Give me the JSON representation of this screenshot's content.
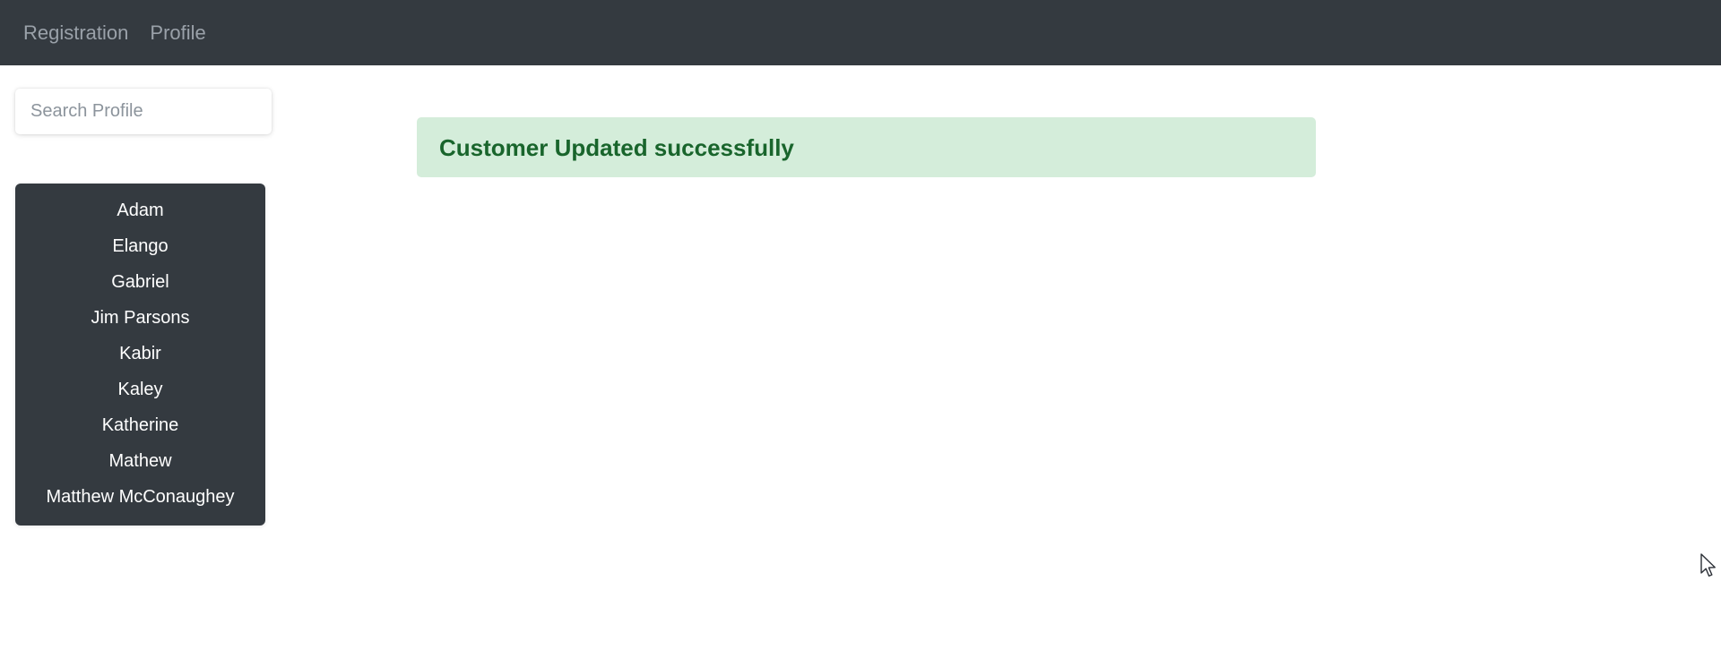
{
  "navbar": {
    "background_color": "#343a40",
    "links": [
      {
        "label": "Registration"
      },
      {
        "label": "Profile"
      }
    ]
  },
  "sidebar": {
    "search": {
      "placeholder": "Search Profile",
      "value": ""
    },
    "list_background_color": "#343a40",
    "profiles": [
      {
        "name": "Adam"
      },
      {
        "name": "Elango"
      },
      {
        "name": "Gabriel"
      },
      {
        "name": "Jim Parsons"
      },
      {
        "name": "Kabir"
      },
      {
        "name": "Kaley"
      },
      {
        "name": "Katherine"
      },
      {
        "name": "Mathew"
      },
      {
        "name": "Matthew McConaughey"
      }
    ]
  },
  "main": {
    "alert": {
      "message": "Customer Updated successfully",
      "background_color": "#d4edda",
      "text_color": "#19652c"
    }
  },
  "cursor": {
    "icon": "arrow-pointer-icon"
  }
}
